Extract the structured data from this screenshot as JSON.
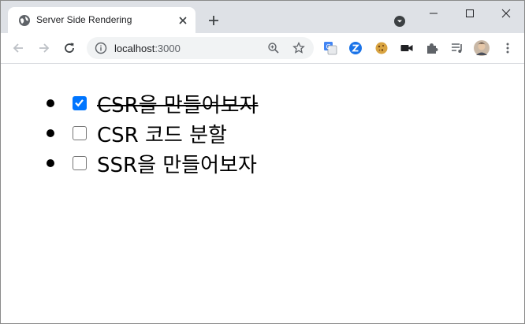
{
  "browser": {
    "tab_title": "Server Side Rendering",
    "url_host": "localhost",
    "url_port": ":3000"
  },
  "todos": [
    {
      "label": "CSR을 만들어보자",
      "done": true
    },
    {
      "label": "CSR 코드 분할",
      "done": false
    },
    {
      "label": "SSR을 만들어보자",
      "done": false
    }
  ],
  "colors": {
    "tabstrip": "#dee1e6",
    "checkbox_checked": "#0075ff"
  }
}
